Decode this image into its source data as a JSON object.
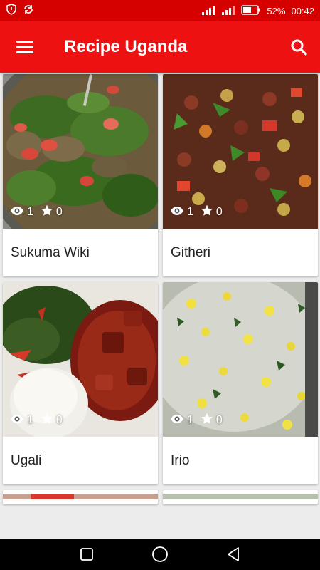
{
  "status_bar": {
    "battery_percent": "52%",
    "time": "00:42",
    "icons": [
      "shield-icon",
      "sync-icon",
      "signal-icon",
      "wifi-icon",
      "battery-icon"
    ]
  },
  "app_bar": {
    "title": "Recipe Uganda",
    "menu_icon": "hamburger-menu-icon",
    "search_icon": "search-icon"
  },
  "recipes": [
    {
      "title": "Sukuma Wiki",
      "views": "1",
      "stars": "0"
    },
    {
      "title": "Githeri",
      "views": "1",
      "stars": "0"
    },
    {
      "title": "Ugali",
      "views": "1",
      "stars": "0"
    },
    {
      "title": "Irio",
      "views": "1",
      "stars": "0"
    }
  ],
  "nav_bar": {
    "icons": [
      "recents-square-icon",
      "home-circle-icon",
      "back-triangle-icon"
    ]
  },
  "colors": {
    "status_bar": "#d50000",
    "app_bar": "#ee1111",
    "background": "#ececec"
  }
}
